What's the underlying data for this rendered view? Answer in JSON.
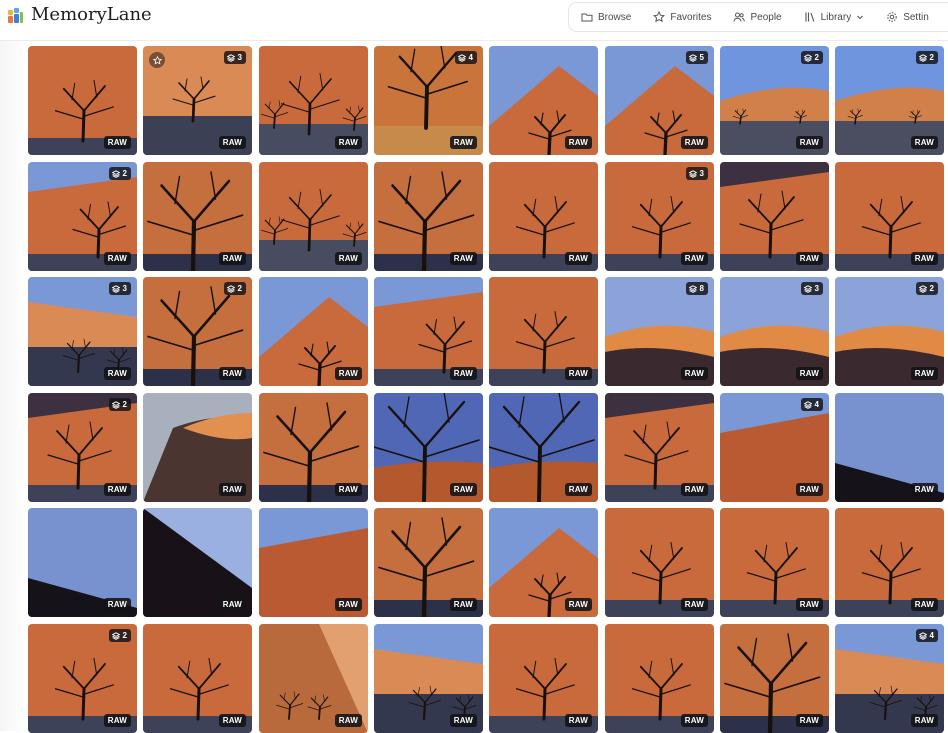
{
  "app": {
    "title": "MemoryLane"
  },
  "nav": {
    "items": [
      {
        "label": "Browse",
        "icon": "folder-icon"
      },
      {
        "label": "Favorites",
        "icon": "star-icon"
      },
      {
        "label": "People",
        "icon": "people-icon"
      },
      {
        "label": "Library",
        "icon": "library-icon",
        "dropdown": true
      },
      {
        "label": "Settin",
        "icon": "gear-icon"
      }
    ]
  },
  "raw_badge": "RAW",
  "photos": [
    {
      "scene": "tree-dune",
      "stack": null,
      "fav": false
    },
    {
      "scene": "tree-dune-pan",
      "stack": "3",
      "fav": true
    },
    {
      "scene": "trees-pan",
      "stack": null,
      "fav": false
    },
    {
      "scene": "big-tree-dune",
      "stack": "4",
      "fav": false
    },
    {
      "scene": "sky-dune-trees",
      "stack": null,
      "fav": false
    },
    {
      "scene": "sky-dune-trees",
      "stack": "5",
      "fav": false
    },
    {
      "scene": "wide-sky",
      "stack": "2",
      "fav": false
    },
    {
      "scene": "wide-sky",
      "stack": "2",
      "fav": false
    },
    {
      "scene": "sky-tree-dune",
      "stack": "2",
      "fav": false
    },
    {
      "scene": "tree-close",
      "stack": null,
      "fav": false
    },
    {
      "scene": "trees-pan",
      "stack": null,
      "fav": false
    },
    {
      "scene": "tree-close",
      "stack": null,
      "fav": false
    },
    {
      "scene": "tree-dune",
      "stack": null,
      "fav": false
    },
    {
      "scene": "tree-dune",
      "stack": "3",
      "fav": false
    },
    {
      "scene": "dark-dune-tree",
      "stack": null,
      "fav": false
    },
    {
      "scene": "tree-dune",
      "stack": null,
      "fav": false
    },
    {
      "scene": "sky-trees-pan",
      "stack": "3",
      "fav": false
    },
    {
      "scene": "tree-close",
      "stack": "2",
      "fav": false
    },
    {
      "scene": "sky-dune-trees",
      "stack": null,
      "fav": false
    },
    {
      "scene": "sky-tree-dune",
      "stack": null,
      "fav": false
    },
    {
      "scene": "tree-dune",
      "stack": null,
      "fav": false
    },
    {
      "scene": "sky-crest",
      "stack": "8",
      "fav": false
    },
    {
      "scene": "sky-crest",
      "stack": "3",
      "fav": false
    },
    {
      "scene": "sky-crest",
      "stack": "2",
      "fav": false
    },
    {
      "scene": "dark-dune-tree",
      "stack": "2",
      "fav": false
    },
    {
      "scene": "grey-sky-crest",
      "stack": null,
      "fav": false
    },
    {
      "scene": "tree-close",
      "stack": null,
      "fav": false
    },
    {
      "scene": "blue-sky-branch",
      "stack": null,
      "fav": false
    },
    {
      "scene": "blue-sky-branch",
      "stack": null,
      "fav": false
    },
    {
      "scene": "dark-dune-tree",
      "stack": null,
      "fav": false
    },
    {
      "scene": "sky-dune-diag",
      "stack": "4",
      "fav": false
    },
    {
      "scene": "blue-dark-slope",
      "stack": null,
      "fav": false
    },
    {
      "scene": "blue-dark-slope",
      "stack": null,
      "fav": false
    },
    {
      "scene": "blue-dark-slope2",
      "stack": null,
      "fav": false
    },
    {
      "scene": "sky-dune-diag",
      "stack": null,
      "fav": false
    },
    {
      "scene": "tree-close",
      "stack": null,
      "fav": false
    },
    {
      "scene": "sky-dune-trees",
      "stack": null,
      "fav": false
    },
    {
      "scene": "tree-dune",
      "stack": null,
      "fav": false
    },
    {
      "scene": "tree-dune",
      "stack": null,
      "fav": false
    },
    {
      "scene": "tree-dune",
      "stack": null,
      "fav": false
    },
    {
      "scene": "tree-dune",
      "stack": "2",
      "fav": false
    },
    {
      "scene": "tree-dune",
      "stack": null,
      "fav": false
    },
    {
      "scene": "shadow-split",
      "stack": null,
      "fav": false
    },
    {
      "scene": "sky-trees-pan",
      "stack": null,
      "fav": false
    },
    {
      "scene": "tree-dune",
      "stack": null,
      "fav": false
    },
    {
      "scene": "tree-dune",
      "stack": null,
      "fav": false
    },
    {
      "scene": "tree-close",
      "stack": null,
      "fav": false
    },
    {
      "scene": "sky-trees-pan",
      "stack": "4",
      "fav": false
    }
  ],
  "colors": {
    "sand": "#c86a3c",
    "sand_light": "#d98a55",
    "sky": "#7a98d6",
    "pan": "#3d4258",
    "tree": "#17100c"
  }
}
